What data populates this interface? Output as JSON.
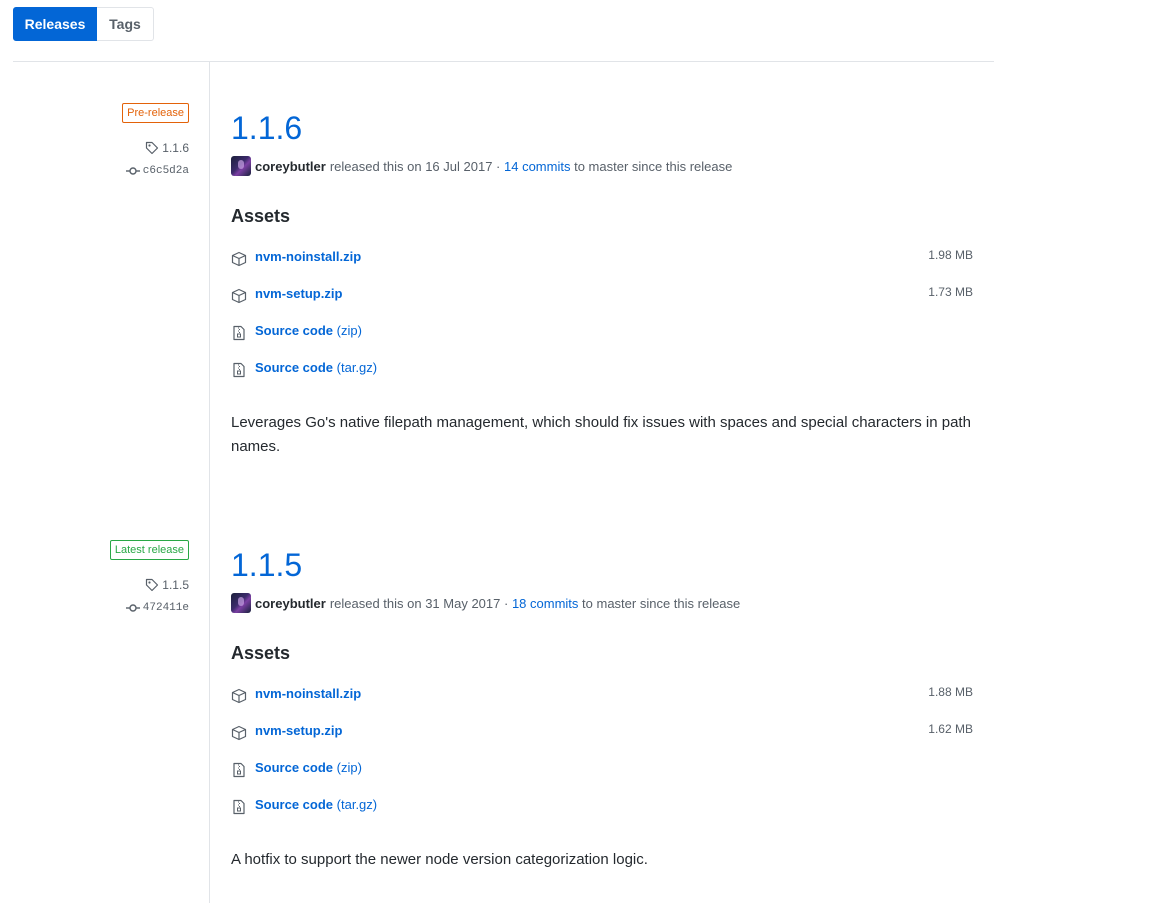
{
  "tabs": {
    "releases": "Releases",
    "tags": "Tags"
  },
  "releases": [
    {
      "label": "Pre-release",
      "tag": "1.1.6",
      "commit": "c6c5d2a",
      "version": "1.1.6",
      "author": "coreybutler",
      "released_text": "released this on 16 Jul 2017 ·",
      "commits_link": "14 commits",
      "commits_suffix": "to master since this release",
      "assets_title": "Assets",
      "assets": [
        {
          "name": "nvm-noinstall.zip",
          "size": "1.98 MB"
        },
        {
          "name": "nvm-setup.zip",
          "size": "1.73 MB"
        },
        {
          "name": "Source code",
          "ext": "(zip)"
        },
        {
          "name": "Source code",
          "ext": "(tar.gz)"
        }
      ],
      "description": "Leverages Go's native filepath management, which should fix issues with spaces and special characters in path names."
    },
    {
      "label": "Latest release",
      "tag": "1.1.5",
      "commit": "472411e",
      "version": "1.1.5",
      "author": "coreybutler",
      "released_text": "released this on 31 May 2017 ·",
      "commits_link": "18 commits",
      "commits_suffix": "to master since this release",
      "assets_title": "Assets",
      "assets": [
        {
          "name": "nvm-noinstall.zip",
          "size": "1.88 MB"
        },
        {
          "name": "nvm-setup.zip",
          "size": "1.62 MB"
        },
        {
          "name": "Source code",
          "ext": "(zip)"
        },
        {
          "name": "Source code",
          "ext": "(tar.gz)"
        }
      ],
      "description": "A hotfix to support the newer node version categorization logic."
    }
  ]
}
